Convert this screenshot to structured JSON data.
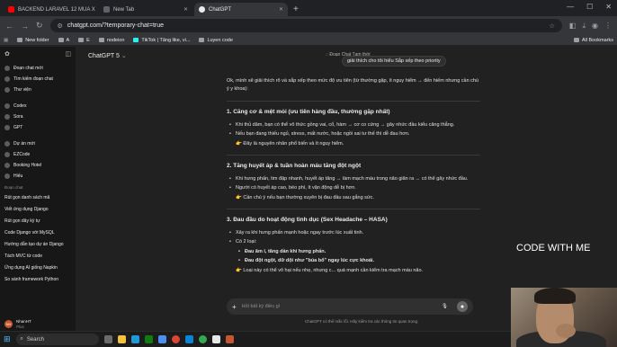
{
  "browser": {
    "tabs": [
      {
        "label": "BACKEND LARAVEL 12 MUA X",
        "color": "#ff0000"
      },
      {
        "label": "New Tab",
        "color": "#5f6368"
      },
      {
        "label": "ChatGPT",
        "color": "#e8eaed"
      }
    ],
    "url": "chatgpt.com/?temporary-chat=true",
    "bookmarks": [
      "New folder",
      "A",
      "E",
      "nodeion",
      "TikTok | Tăng like, vi...",
      "Luyen code"
    ],
    "all_bookmarks": "All Bookmarks"
  },
  "sidebar": {
    "items": [
      {
        "label": "Đoạn chat mới"
      },
      {
        "label": "Tìm kiếm đoạn chat"
      },
      {
        "label": "Thư viện"
      }
    ],
    "gpts": [
      {
        "label": "Codex"
      },
      {
        "label": "Sora"
      },
      {
        "label": "GPT"
      }
    ],
    "projects": [
      {
        "label": "Dự án mới"
      },
      {
        "label": "EZCode"
      },
      {
        "label": "Booking Hotel"
      },
      {
        "label": "Hiếu"
      }
    ],
    "section_title": "Đoạn chat",
    "chats": [
      "Rút gọn danh sách mã",
      "Viết ứng dụng Django",
      "Rút gọn dây kỳ tự",
      "Code Django với MySQL",
      "Hướng dẫn tạo dự án Django",
      "Tách MVC từ code",
      "Ứng dụng AI giống Napkin",
      "So sánh framework Python"
    ],
    "user": {
      "initials": "NH",
      "name": "NhanHT",
      "plan": "Plus"
    }
  },
  "main": {
    "model": "ChatGPT 5",
    "temp_chat": "Đoạn Chat Tạm thời",
    "tooltip": "giải thích cho tôi hiểu Sắp xếp theo priority",
    "intro": "Ok, mình sẽ giải thích rõ và sắp xếp theo mức độ ưu tiên (từ thường gặp, ít nguy hiểm → đến hiếm nhưng cần chú ý y khoa):",
    "sections": [
      {
        "title": "1. Căng cơ & mệt mỏi (ưu tiên hàng đầu, thường gặp nhất)",
        "bullets": [
          "Khi thủ dâm, bạn có thể vô thức gồng vai, cổ, hàm → cơ co cứng → gây nhức đầu kiểu căng thẳng.",
          "Nếu bạn đang thiếu ngủ, stress, mất nước, hoặc ngồi sai tư thế thì dễ đau hơn."
        ],
        "note": "👉 Đây là nguyên nhân phổ biến và ít nguy hiểm."
      },
      {
        "title": "2. Tăng huyết áp & tuần hoàn máu tăng đột ngột",
        "bullets": [
          "Khi hưng phấn, tim đập nhanh, huyết áp tăng → làm mạch máu trong não giãn ra → có thể gây nhức đầu.",
          "Người có huyết áp cao, béo phì, ít vận động dễ bị hơn."
        ],
        "note": "👉 Cần chú ý nếu bạn thường xuyên bị đau đầu sau gắng sức."
      },
      {
        "title": "3. Đau đầu do hoạt động tình dục (Sex Headache – HASA)",
        "bullets": [
          "Xảy ra khi hưng phấn mạnh hoặc ngay trước lúc xuất tinh.",
          "Có 2 loại:"
        ],
        "subs": [
          "Đau âm ỉ, tăng dần khi hưng phấn.",
          "Đau đột ngột, dữ dội như \"búa bổ\" ngay lúc cực khoái."
        ],
        "note": "👉 Loại này có thể vô hại nếu nhẹ, nhưng c... quá mạnh cần kiểm tra mạch máu não."
      }
    ],
    "input_placeholder": "Hỏi bất kỳ điều gì",
    "disclaimer": "ChatGPT có thể mắc lỗi. Hãy kiểm tra các thông tin quan trọng."
  },
  "taskbar": {
    "search_label": "Search"
  },
  "overlay_text": "CODE WITH ME"
}
